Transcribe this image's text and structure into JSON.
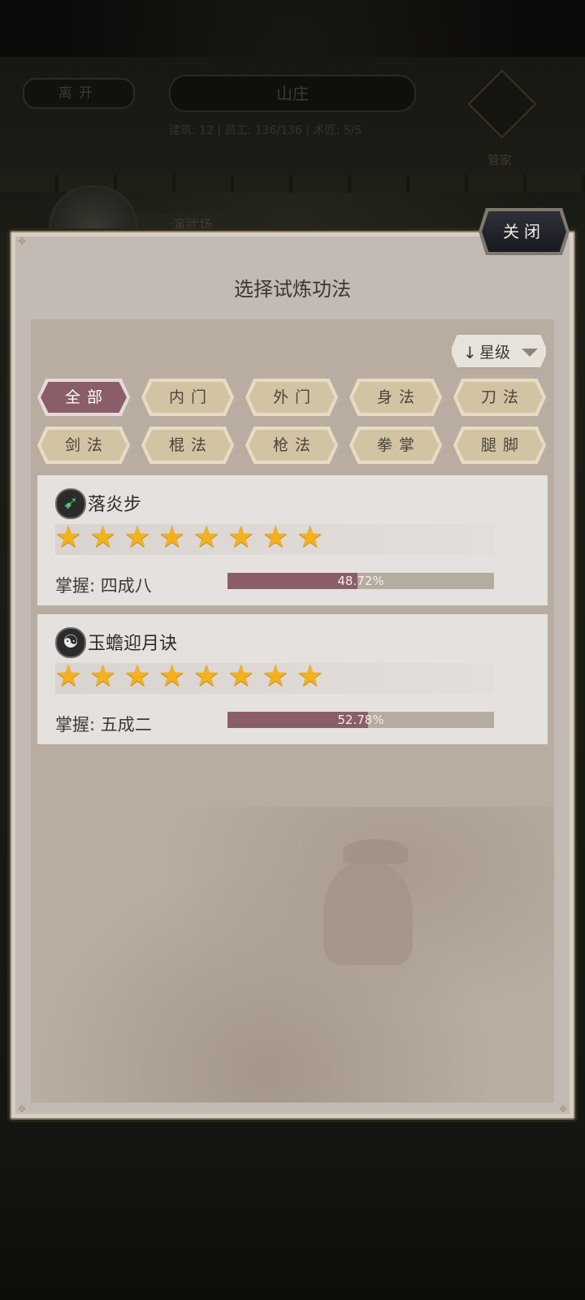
{
  "background": {
    "leave_label": "离开",
    "estate_title": "山庄",
    "stats_text": "建筑: 12 | 员工: 136/136 | 术匠: 5/5",
    "manager_label": "管家",
    "place_label": "演武场"
  },
  "modal": {
    "close_label": "关闭",
    "title": "选择试炼功法",
    "sort": {
      "arrow": "↓",
      "label": "星级"
    },
    "filters": [
      {
        "label": "全部",
        "active": true
      },
      {
        "label": "内门",
        "active": false
      },
      {
        "label": "外门",
        "active": false
      },
      {
        "label": "身法",
        "active": false
      },
      {
        "label": "刀法",
        "active": false
      },
      {
        "label": "剑法",
        "active": false
      },
      {
        "label": "棍法",
        "active": false
      },
      {
        "label": "枪法",
        "active": false
      },
      {
        "label": "拳掌",
        "active": false
      },
      {
        "label": "腿脚",
        "active": false
      }
    ],
    "skills": [
      {
        "name": "落炎步",
        "icon": "footstep-icon",
        "stars": 8,
        "mastery_label": "掌握: 四成八",
        "progress": 48.72,
        "progress_text": "48.72%"
      },
      {
        "name": "玉蟾迎月诀",
        "icon": "yin-yang-icon",
        "stars": 8,
        "mastery_label": "掌握: 五成二",
        "progress": 52.78,
        "progress_text": "52.78%"
      }
    ]
  },
  "colors": {
    "accent": "#8a5e68",
    "panel": "#c3bbb3",
    "star": "#f3b21c"
  }
}
